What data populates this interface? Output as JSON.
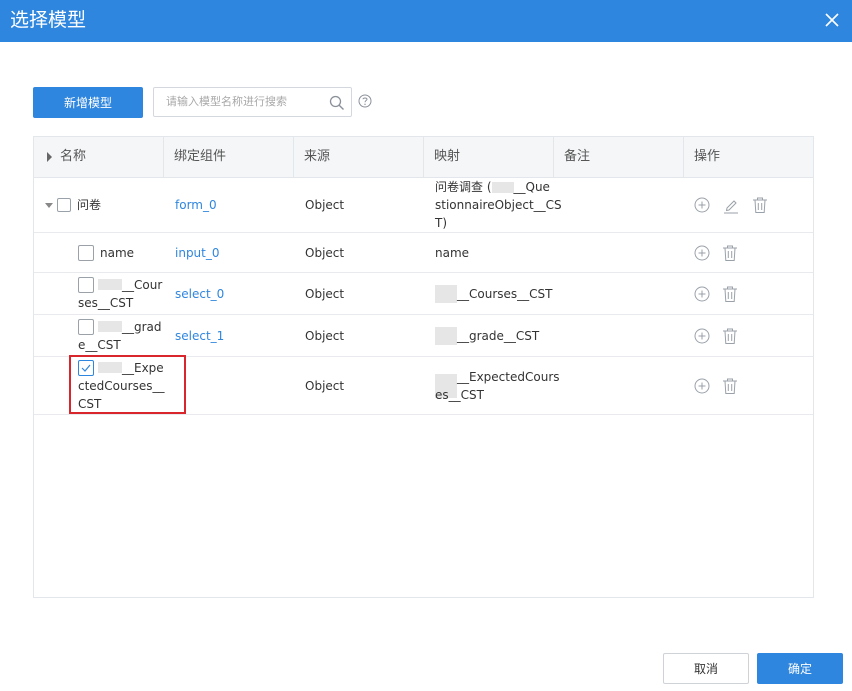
{
  "dialog": {
    "title": "选择模型"
  },
  "toolbar": {
    "add_label": "新增模型",
    "search_placeholder": "请输入模型名称进行搜索"
  },
  "table": {
    "headers": [
      "名称",
      "绑定组件",
      "来源",
      "映射",
      "备注",
      "操作"
    ],
    "rows": [
      {
        "name": "问卷",
        "component": "form_0",
        "source": "Object",
        "mapping_l1": "问卷调查 (",
        "mapping_l1b": "__Que",
        "mapping_l2": "stionnaireObject__CS",
        "mapping_l3": "T)"
      },
      {
        "name": "name",
        "component": "input_0",
        "source": "Object",
        "mapping": "name"
      },
      {
        "name_suffix": "__Cour",
        "name_l2": "ses__CST",
        "component": "select_0",
        "source": "Object",
        "mapping": "__Courses__CST"
      },
      {
        "name_suffix": "__grad",
        "name_l2": "e__CST",
        "component": "select_1",
        "source": "Object",
        "mapping": "__grade__CST"
      },
      {
        "name_suffix": "__Expe",
        "name_l2": "ctedCourses__",
        "name_l3": "CST",
        "component": "",
        "source": "Object",
        "mapping_l1": "__ExpectedCours",
        "mapping_l2": "es__CST",
        "checked": true
      }
    ]
  },
  "footer": {
    "cancel_label": "取消",
    "ok_label": "确定"
  }
}
